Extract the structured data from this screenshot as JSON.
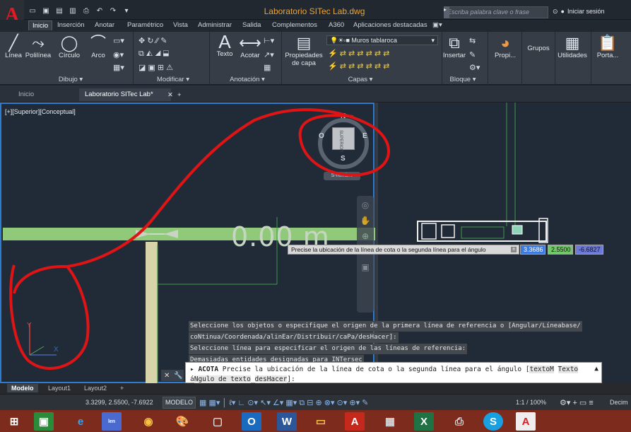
{
  "app": {
    "logo": "A",
    "title": "Laboratorio SITec Lab.dwg",
    "search_placeholder": "Escriba palabra clave o frase",
    "signin": "Iniciar sesión"
  },
  "quick_access": [
    "new-icon",
    "open-icon",
    "save-icon",
    "saveas-icon",
    "print-icon",
    "undo-icon",
    "redo-icon",
    "dropdown-icon"
  ],
  "ribbon_tabs": [
    "Inicio",
    "Inserción",
    "Anotar",
    "Paramétrico",
    "Vista",
    "Administrar",
    "Salida",
    "Complementos",
    "A360",
    "Aplicaciones destacadas"
  ],
  "ribbon": {
    "draw": {
      "linea": "Línea",
      "polilinea": "Polilínea",
      "circulo": "Círculo",
      "arco": "Arco",
      "panel": "Dibujo ▾"
    },
    "modify": {
      "panel": "Modificar ▾"
    },
    "annotation": {
      "texto": "Texto",
      "acotar": "Acotar",
      "panel": "Anotación ▾"
    },
    "layers": {
      "props": "Propiedades de capa",
      "current_layer": "Muros tablaroca",
      "panel": "Capas ▾"
    },
    "block": {
      "insertar": "Insertar",
      "panel": "Bloque ▾"
    },
    "propi": "Propi...",
    "grupos": "Grupos",
    "utilidades": "Utilidades",
    "porta": "Porta..."
  },
  "file_tabs": [
    "Inicio",
    "Laboratorio SITec Lab*"
  ],
  "viewport": {
    "label": "[+][Superior][Conceptual]",
    "compass": {
      "n": "N",
      "s": "S",
      "e": "E",
      "o": "O"
    },
    "cube_face": "SUPERIOR",
    "wcs": "S-nombre",
    "dim_text": "0.00 m"
  },
  "dim_input": {
    "tooltip": "Precise la ubicación de la línea de cota o la segunda línea para el ángulo",
    "x": "3.3686",
    "y": "2.5500",
    "z": "-6.6827"
  },
  "command_history": [
    "Seleccione los objetos o especifique el origen de la primera línea de referencia o [Angular/Líneabase/",
    "coNtinua/Coordenada/alinEar/Distribuir/caPa/desHacer]:",
    "Seleccione línea para especificar el origen de las líneas de referencia:",
    "Demasiadas entidades designadas para INTersec"
  ],
  "command_line": {
    "cmd": "ACOTA",
    "prompt": "Precise la ubicación de la línea de cota o la segunda línea para el ángulo [",
    "opt1": "textoM",
    "opt2": "Texto",
    "opt3_pre": "á",
    "opt3": "Ngulo de texto",
    "opt4": "desHacer",
    "end": "]:"
  },
  "layout_tabs": [
    "Modelo",
    "Layout1",
    "Layout2"
  ],
  "status": {
    "coords": "3.3299, 2.5500, -7.6922",
    "model": "MODELO",
    "scale": "1:1 / 100%",
    "units": "Decim"
  },
  "taskbar_apps": [
    "start",
    "store",
    "ie",
    "lenovo",
    "chrome",
    "paint",
    "photos",
    "outlook",
    "word",
    "explorer",
    "acrobat",
    "calculator",
    "excel",
    "printer",
    "skype",
    "autocad"
  ]
}
